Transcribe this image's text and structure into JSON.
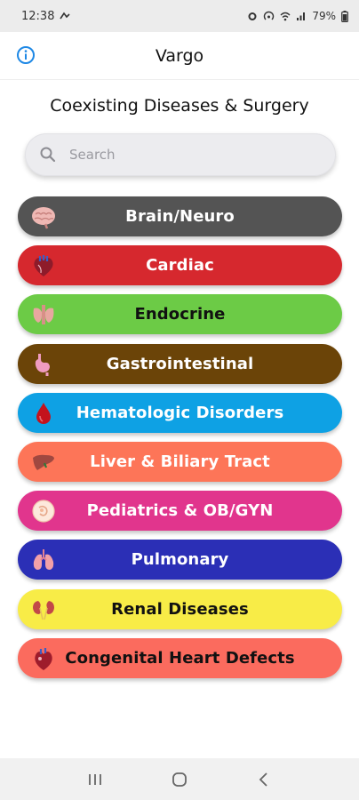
{
  "status_bar": {
    "time": "12:38",
    "battery": "79%"
  },
  "header": {
    "title": "Vargo"
  },
  "page": {
    "title": "Coexisting Diseases & Surgery"
  },
  "search": {
    "placeholder": "Search",
    "value": ""
  },
  "categories": [
    {
      "label": "Brain/Neuro",
      "icon": "brain-icon",
      "bg": "#545454",
      "fg": "#ffffff"
    },
    {
      "label": "Cardiac",
      "icon": "heart-icon",
      "bg": "#d6282e",
      "fg": "#ffffff"
    },
    {
      "label": "Endocrine",
      "icon": "thyroid-icon",
      "bg": "#6ccb46",
      "fg": "#111111"
    },
    {
      "label": "Gastrointestinal",
      "icon": "stomach-icon",
      "bg": "#6b4408",
      "fg": "#ffffff"
    },
    {
      "label": "Hematologic Disorders",
      "icon": "blood-drop-icon",
      "bg": "#0ea1e4",
      "fg": "#ffffff"
    },
    {
      "label": "Liver & Biliary Tract",
      "icon": "liver-icon",
      "bg": "#fd7558",
      "fg": "#ffffff"
    },
    {
      "label": "Pediatrics & OB/GYN",
      "icon": "baby-icon",
      "bg": "#e1358d",
      "fg": "#ffffff"
    },
    {
      "label": "Pulmonary",
      "icon": "lungs-icon",
      "bg": "#2b2fb6",
      "fg": "#ffffff"
    },
    {
      "label": "Renal Diseases",
      "icon": "kidneys-icon",
      "bg": "#f8ec47",
      "fg": "#111111"
    },
    {
      "label": "Congenital Heart Defects",
      "icon": "anatomical-heart-icon",
      "bg": "#fb6b5e",
      "fg": "#111111"
    }
  ],
  "colors": {
    "accent": "#1e88e5",
    "status_bar_bg": "#ececec",
    "nav_bar_bg": "#f1f1f1"
  }
}
